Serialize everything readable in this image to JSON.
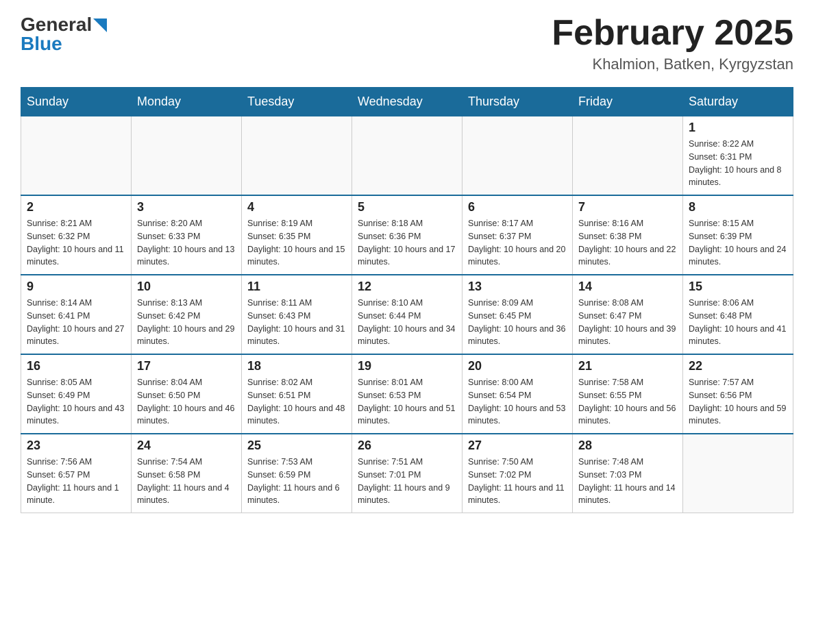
{
  "header": {
    "logo": {
      "general": "General",
      "blue": "Blue"
    },
    "title": "February 2025",
    "location": "Khalmion, Batken, Kyrgyzstan"
  },
  "calendar": {
    "days_of_week": [
      "Sunday",
      "Monday",
      "Tuesday",
      "Wednesday",
      "Thursday",
      "Friday",
      "Saturday"
    ],
    "weeks": [
      [
        {
          "day": "",
          "sunrise": "",
          "sunset": "",
          "daylight": ""
        },
        {
          "day": "",
          "sunrise": "",
          "sunset": "",
          "daylight": ""
        },
        {
          "day": "",
          "sunrise": "",
          "sunset": "",
          "daylight": ""
        },
        {
          "day": "",
          "sunrise": "",
          "sunset": "",
          "daylight": ""
        },
        {
          "day": "",
          "sunrise": "",
          "sunset": "",
          "daylight": ""
        },
        {
          "day": "",
          "sunrise": "",
          "sunset": "",
          "daylight": ""
        },
        {
          "day": "1",
          "sunrise": "Sunrise: 8:22 AM",
          "sunset": "Sunset: 6:31 PM",
          "daylight": "Daylight: 10 hours and 8 minutes."
        }
      ],
      [
        {
          "day": "2",
          "sunrise": "Sunrise: 8:21 AM",
          "sunset": "Sunset: 6:32 PM",
          "daylight": "Daylight: 10 hours and 11 minutes."
        },
        {
          "day": "3",
          "sunrise": "Sunrise: 8:20 AM",
          "sunset": "Sunset: 6:33 PM",
          "daylight": "Daylight: 10 hours and 13 minutes."
        },
        {
          "day": "4",
          "sunrise": "Sunrise: 8:19 AM",
          "sunset": "Sunset: 6:35 PM",
          "daylight": "Daylight: 10 hours and 15 minutes."
        },
        {
          "day": "5",
          "sunrise": "Sunrise: 8:18 AM",
          "sunset": "Sunset: 6:36 PM",
          "daylight": "Daylight: 10 hours and 17 minutes."
        },
        {
          "day": "6",
          "sunrise": "Sunrise: 8:17 AM",
          "sunset": "Sunset: 6:37 PM",
          "daylight": "Daylight: 10 hours and 20 minutes."
        },
        {
          "day": "7",
          "sunrise": "Sunrise: 8:16 AM",
          "sunset": "Sunset: 6:38 PM",
          "daylight": "Daylight: 10 hours and 22 minutes."
        },
        {
          "day": "8",
          "sunrise": "Sunrise: 8:15 AM",
          "sunset": "Sunset: 6:39 PM",
          "daylight": "Daylight: 10 hours and 24 minutes."
        }
      ],
      [
        {
          "day": "9",
          "sunrise": "Sunrise: 8:14 AM",
          "sunset": "Sunset: 6:41 PM",
          "daylight": "Daylight: 10 hours and 27 minutes."
        },
        {
          "day": "10",
          "sunrise": "Sunrise: 8:13 AM",
          "sunset": "Sunset: 6:42 PM",
          "daylight": "Daylight: 10 hours and 29 minutes."
        },
        {
          "day": "11",
          "sunrise": "Sunrise: 8:11 AM",
          "sunset": "Sunset: 6:43 PM",
          "daylight": "Daylight: 10 hours and 31 minutes."
        },
        {
          "day": "12",
          "sunrise": "Sunrise: 8:10 AM",
          "sunset": "Sunset: 6:44 PM",
          "daylight": "Daylight: 10 hours and 34 minutes."
        },
        {
          "day": "13",
          "sunrise": "Sunrise: 8:09 AM",
          "sunset": "Sunset: 6:45 PM",
          "daylight": "Daylight: 10 hours and 36 minutes."
        },
        {
          "day": "14",
          "sunrise": "Sunrise: 8:08 AM",
          "sunset": "Sunset: 6:47 PM",
          "daylight": "Daylight: 10 hours and 39 minutes."
        },
        {
          "day": "15",
          "sunrise": "Sunrise: 8:06 AM",
          "sunset": "Sunset: 6:48 PM",
          "daylight": "Daylight: 10 hours and 41 minutes."
        }
      ],
      [
        {
          "day": "16",
          "sunrise": "Sunrise: 8:05 AM",
          "sunset": "Sunset: 6:49 PM",
          "daylight": "Daylight: 10 hours and 43 minutes."
        },
        {
          "day": "17",
          "sunrise": "Sunrise: 8:04 AM",
          "sunset": "Sunset: 6:50 PM",
          "daylight": "Daylight: 10 hours and 46 minutes."
        },
        {
          "day": "18",
          "sunrise": "Sunrise: 8:02 AM",
          "sunset": "Sunset: 6:51 PM",
          "daylight": "Daylight: 10 hours and 48 minutes."
        },
        {
          "day": "19",
          "sunrise": "Sunrise: 8:01 AM",
          "sunset": "Sunset: 6:53 PM",
          "daylight": "Daylight: 10 hours and 51 minutes."
        },
        {
          "day": "20",
          "sunrise": "Sunrise: 8:00 AM",
          "sunset": "Sunset: 6:54 PM",
          "daylight": "Daylight: 10 hours and 53 minutes."
        },
        {
          "day": "21",
          "sunrise": "Sunrise: 7:58 AM",
          "sunset": "Sunset: 6:55 PM",
          "daylight": "Daylight: 10 hours and 56 minutes."
        },
        {
          "day": "22",
          "sunrise": "Sunrise: 7:57 AM",
          "sunset": "Sunset: 6:56 PM",
          "daylight": "Daylight: 10 hours and 59 minutes."
        }
      ],
      [
        {
          "day": "23",
          "sunrise": "Sunrise: 7:56 AM",
          "sunset": "Sunset: 6:57 PM",
          "daylight": "Daylight: 11 hours and 1 minute."
        },
        {
          "day": "24",
          "sunrise": "Sunrise: 7:54 AM",
          "sunset": "Sunset: 6:58 PM",
          "daylight": "Daylight: 11 hours and 4 minutes."
        },
        {
          "day": "25",
          "sunrise": "Sunrise: 7:53 AM",
          "sunset": "Sunset: 6:59 PM",
          "daylight": "Daylight: 11 hours and 6 minutes."
        },
        {
          "day": "26",
          "sunrise": "Sunrise: 7:51 AM",
          "sunset": "Sunset: 7:01 PM",
          "daylight": "Daylight: 11 hours and 9 minutes."
        },
        {
          "day": "27",
          "sunrise": "Sunrise: 7:50 AM",
          "sunset": "Sunset: 7:02 PM",
          "daylight": "Daylight: 11 hours and 11 minutes."
        },
        {
          "day": "28",
          "sunrise": "Sunrise: 7:48 AM",
          "sunset": "Sunset: 7:03 PM",
          "daylight": "Daylight: 11 hours and 14 minutes."
        },
        {
          "day": "",
          "sunrise": "",
          "sunset": "",
          "daylight": ""
        }
      ]
    ]
  }
}
